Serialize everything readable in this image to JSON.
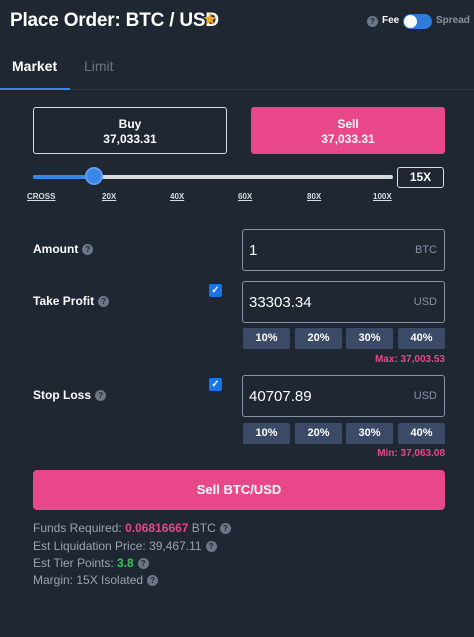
{
  "header": {
    "title": "Place Order: BTC / USD",
    "star_icon": "star-icon",
    "fee_label": "Fee",
    "spread_label": "Spread",
    "fee_toggle_on": true
  },
  "tabs": [
    {
      "label": "Market",
      "active": true
    },
    {
      "label": "Limit",
      "active": false
    }
  ],
  "side": {
    "buy_label": "Buy",
    "buy_price": "37,033.31",
    "sell_label": "Sell",
    "sell_price": "37,033.31",
    "selected": "Sell"
  },
  "leverage": {
    "value": "15X",
    "ticks": [
      "CROSS",
      "20X",
      "40X",
      "60X",
      "80X",
      "100X"
    ],
    "slider_fraction": 0.17
  },
  "amount": {
    "label": "Amount",
    "value": "1",
    "unit": "BTC"
  },
  "take_profit": {
    "label": "Take Profit",
    "checked": true,
    "value": "33303.34",
    "unit": "USD",
    "percents": [
      "10%",
      "20%",
      "30%",
      "40%"
    ],
    "limit_note": "Max: 37,003.53"
  },
  "stop_loss": {
    "label": "Stop Loss",
    "checked": true,
    "value": "40707.89",
    "unit": "USD",
    "percents": [
      "10%",
      "20%",
      "30%",
      "40%"
    ],
    "limit_note": "Min: 37,063.08"
  },
  "submit": {
    "label": "Sell BTC/USD"
  },
  "info": {
    "funds_label": "Funds Required: ",
    "funds_value": "0.06816667",
    "funds_unit": " BTC",
    "liq_label": "Est Liquidation Price: ",
    "liq_value": "39,467.11",
    "tier_label": "Est Tier Points: ",
    "tier_value": "3.8",
    "margin_label": "Margin: ",
    "margin_value": "15X Isolated"
  },
  "colors": {
    "background": "#1f2733",
    "accent_blue": "#3a86e8",
    "sell_pink": "#e8478a",
    "tier_green": "#3bc45b",
    "star_gold": "#f5a623"
  }
}
